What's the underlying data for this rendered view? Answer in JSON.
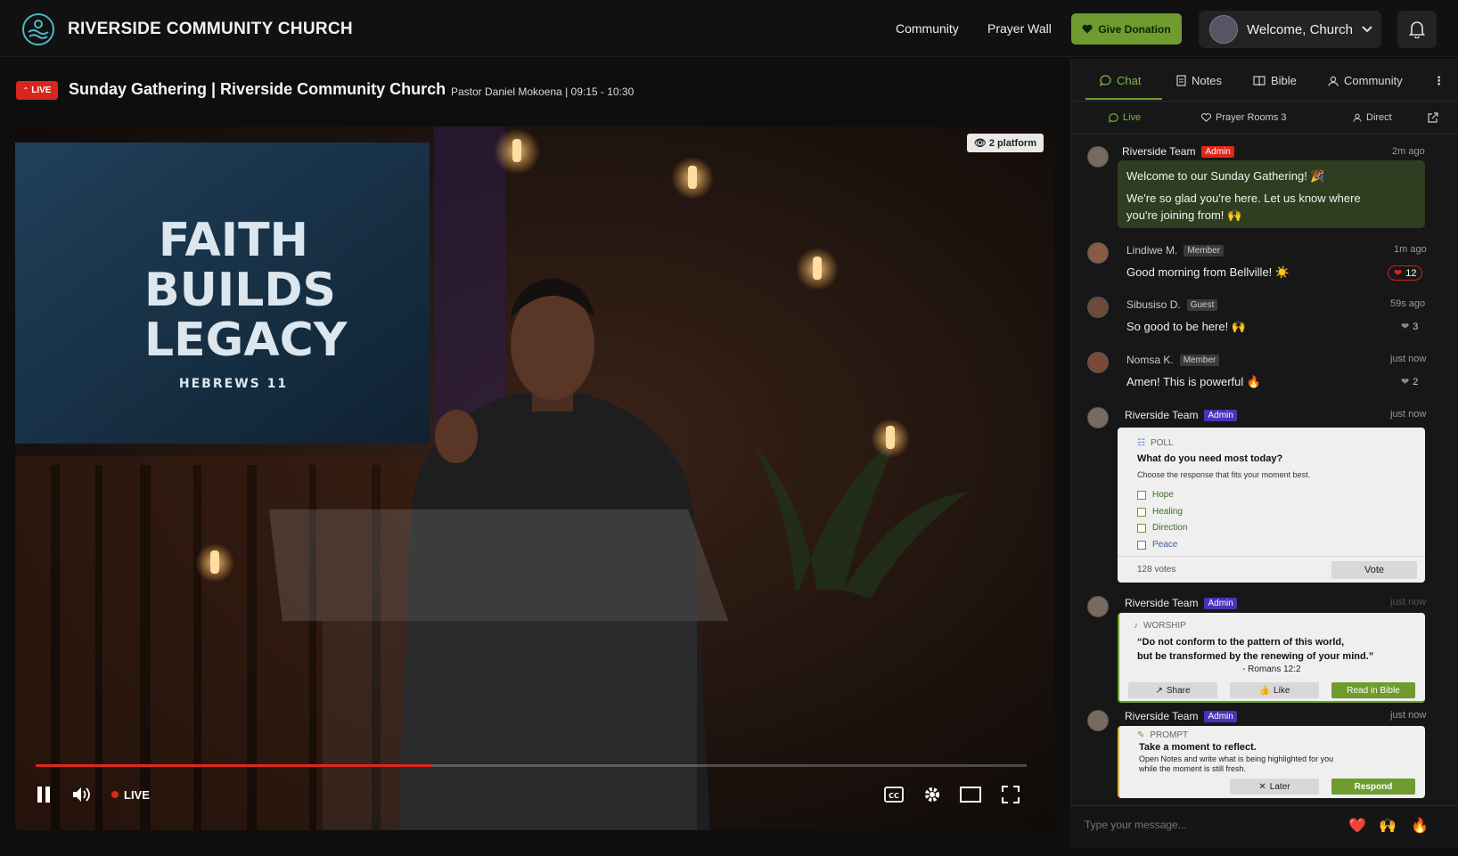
{
  "brand": {
    "name": "RIVERSIDE COMMUNITY CHURCH",
    "logo_icon": "church-wave-logo"
  },
  "nav": {
    "community": "Community",
    "prayer_wall": "Prayer Wall",
    "donate": "Give Donation",
    "welcome": "Welcome, Church"
  },
  "stream": {
    "live_badge": "LIVE",
    "title": "Sunday Gathering | Riverside Community Church",
    "subtitle": "Pastor Daniel Mokoena | 09:15 - 10:30",
    "viewers": "2 platform",
    "live_label": "LIVE",
    "progress_fraction": 0.4,
    "slide_lines": [
      "FAITH",
      "BUILDS",
      "LEGACY"
    ],
    "slide_ref": "HEBREWS 11"
  },
  "panel": {
    "tabs": [
      "Chat",
      "Notes",
      "Bible",
      "Community"
    ],
    "subtabs": [
      "Live",
      "Prayer Rooms 3",
      "Direct"
    ]
  },
  "messages": [
    {
      "name": "Riverside Team",
      "badge": "Admin",
      "time": "2m ago",
      "text1": "Welcome to our Sunday Gathering! 🎉",
      "text2": "We're so glad you're here. Let us know where",
      "text3": "you're joining from! 🙌"
    },
    {
      "name": "Lindiwe M.",
      "badge": "Member",
      "time": "1m ago",
      "text": "Good morning from Bellville! ☀️",
      "likes": "12"
    },
    {
      "name": "Sibusiso D.",
      "badge": "Guest",
      "time": "59s ago",
      "text": "So good to be here! 🙌",
      "likes": "3"
    },
    {
      "name": "Nomsa K.",
      "badge": "Member",
      "time": "just now",
      "text": "Amen! This is powerful 🔥",
      "likes": "2"
    }
  ],
  "poll": {
    "name": "Riverside Team",
    "badge": "Admin",
    "time": "just now",
    "tag": "POLL",
    "question": "What do you need most today?",
    "hint": "Choose the response that fits your moment best.",
    "options": [
      "Hope",
      "Healing",
      "Direction",
      "Peace"
    ],
    "votes": "128 votes",
    "vote_label": "Vote"
  },
  "worship": {
    "name": "Riverside Team",
    "badge": "Admin",
    "time": "just now",
    "tag": "WORSHIP",
    "line1": "“Do not conform to the pattern of this world,",
    "line2": "but be transformed by the renewing of your mind.”",
    "ref": "- Romans 12:2",
    "share": "Share",
    "like": "Like",
    "read": "Read in Bible"
  },
  "prompt": {
    "name": "Riverside Team",
    "badge": "Admin",
    "time": "just now",
    "tag": "PROMPT",
    "title": "Take a moment to reflect.",
    "line1": "Open Notes and write what is being highlighted for you",
    "line2": "while the moment is still fresh.",
    "later": "Later",
    "respond": "Respond"
  },
  "composer": {
    "placeholder": "Type your message...",
    "emojis": [
      "❤️",
      "🙌",
      "🔥"
    ]
  }
}
